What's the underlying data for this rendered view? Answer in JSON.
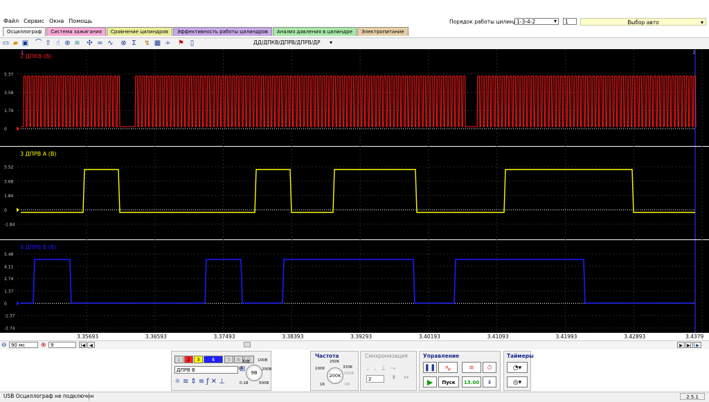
{
  "menu": [
    "Файл",
    "Сервис",
    "Окна",
    "Помощь"
  ],
  "header": {
    "cyl_order_label": "Порядок работы цилиндров",
    "cyl_order_value": "1-3-4-2",
    "cyl_spin_value": "1",
    "car_select": "Выбор авто"
  },
  "tabs": [
    {
      "label": "Осциллограф",
      "color": "#f4f4f4"
    },
    {
      "label": "Система зажигания",
      "color": "#f5a9d6"
    },
    {
      "label": "Сравнение цилиндров",
      "color": "#e9eb98"
    },
    {
      "label": "Эффективность работы цилиндров",
      "color": "#c7a7e6"
    },
    {
      "label": "Анализ давления в цилиндре",
      "color": "#a7e6a7"
    },
    {
      "label": "Электропитание",
      "color": "#e6cfa7"
    }
  ],
  "toolbar": {
    "mode_label": "ДД/ДПКВ/ДПРВ/ДПРВ/ДР",
    "icons": [
      "new-icon",
      "open-icon",
      "save-icon",
      "probe-icon",
      "cursor-icon",
      "hand-icon",
      "zoom-icon",
      "spectrum-icon",
      "measure-icon",
      "compare-icon",
      "filter-icon",
      "trigger-icon",
      "sigma-icon",
      "marker-icon",
      "grid-icon",
      "divide-icon",
      "flag-icon",
      "page-icon"
    ]
  },
  "colors": {
    "ch2": "#ff1a1a",
    "ch3": "#ffff00",
    "ch4": "#1a1aff"
  },
  "chart_data": {
    "type": "line",
    "x_ticks": [
      "3.35693",
      "3.36593",
      "3.37493",
      "3.38393",
      "3.39293",
      "3.40193",
      "3.41093",
      "3.41993",
      "3.42893",
      "3.4379"
    ],
    "series": [
      {
        "name": "2 ДПКВ (В)",
        "y_ticks": [
          "5.37",
          "3.58",
          "1.79",
          "0"
        ],
        "ylim": [
          0,
          5.37
        ]
      },
      {
        "name": "3 ДПРВ A (В)",
        "y_ticks": [
          "5.52",
          "3.68",
          "1.84",
          "0",
          "-1.84"
        ],
        "ylim": [
          -1.84,
          5.52
        ]
      },
      {
        "name": "4 ДПРВ B (В)",
        "y_ticks": [
          "5.48",
          "4.11",
          "2.74",
          "1.37",
          "0",
          "-1.37",
          "-2.74"
        ],
        "ylim": [
          -2.74,
          5.48
        ]
      }
    ]
  },
  "scroll": {
    "time_div": "90 мс",
    "count": "9"
  },
  "bottom": {
    "channels": [
      "1",
      "2",
      "3",
      "4",
      "5",
      "6",
      "D"
    ],
    "channel_name": "ДПРВ B",
    "volt_knob": "9В",
    "volt_marks": [
      "10В",
      "100В",
      "1В",
      "200В",
      "0.1В",
      "500В"
    ],
    "freq_title": "Частота",
    "freq_knob": "200K",
    "freq_marks": [
      "250K",
      "100K",
      "333K",
      "500K",
      "1K",
      "1M"
    ],
    "sync_title": "Синхронизация",
    "sync_value": "2",
    "control_title": "Управление",
    "start_label": "Пуск",
    "control_value": "13.00",
    "timers_title": "Таймеры"
  },
  "status": {
    "text": "USB Осциллограф не подключен",
    "version": "2.5.1"
  }
}
